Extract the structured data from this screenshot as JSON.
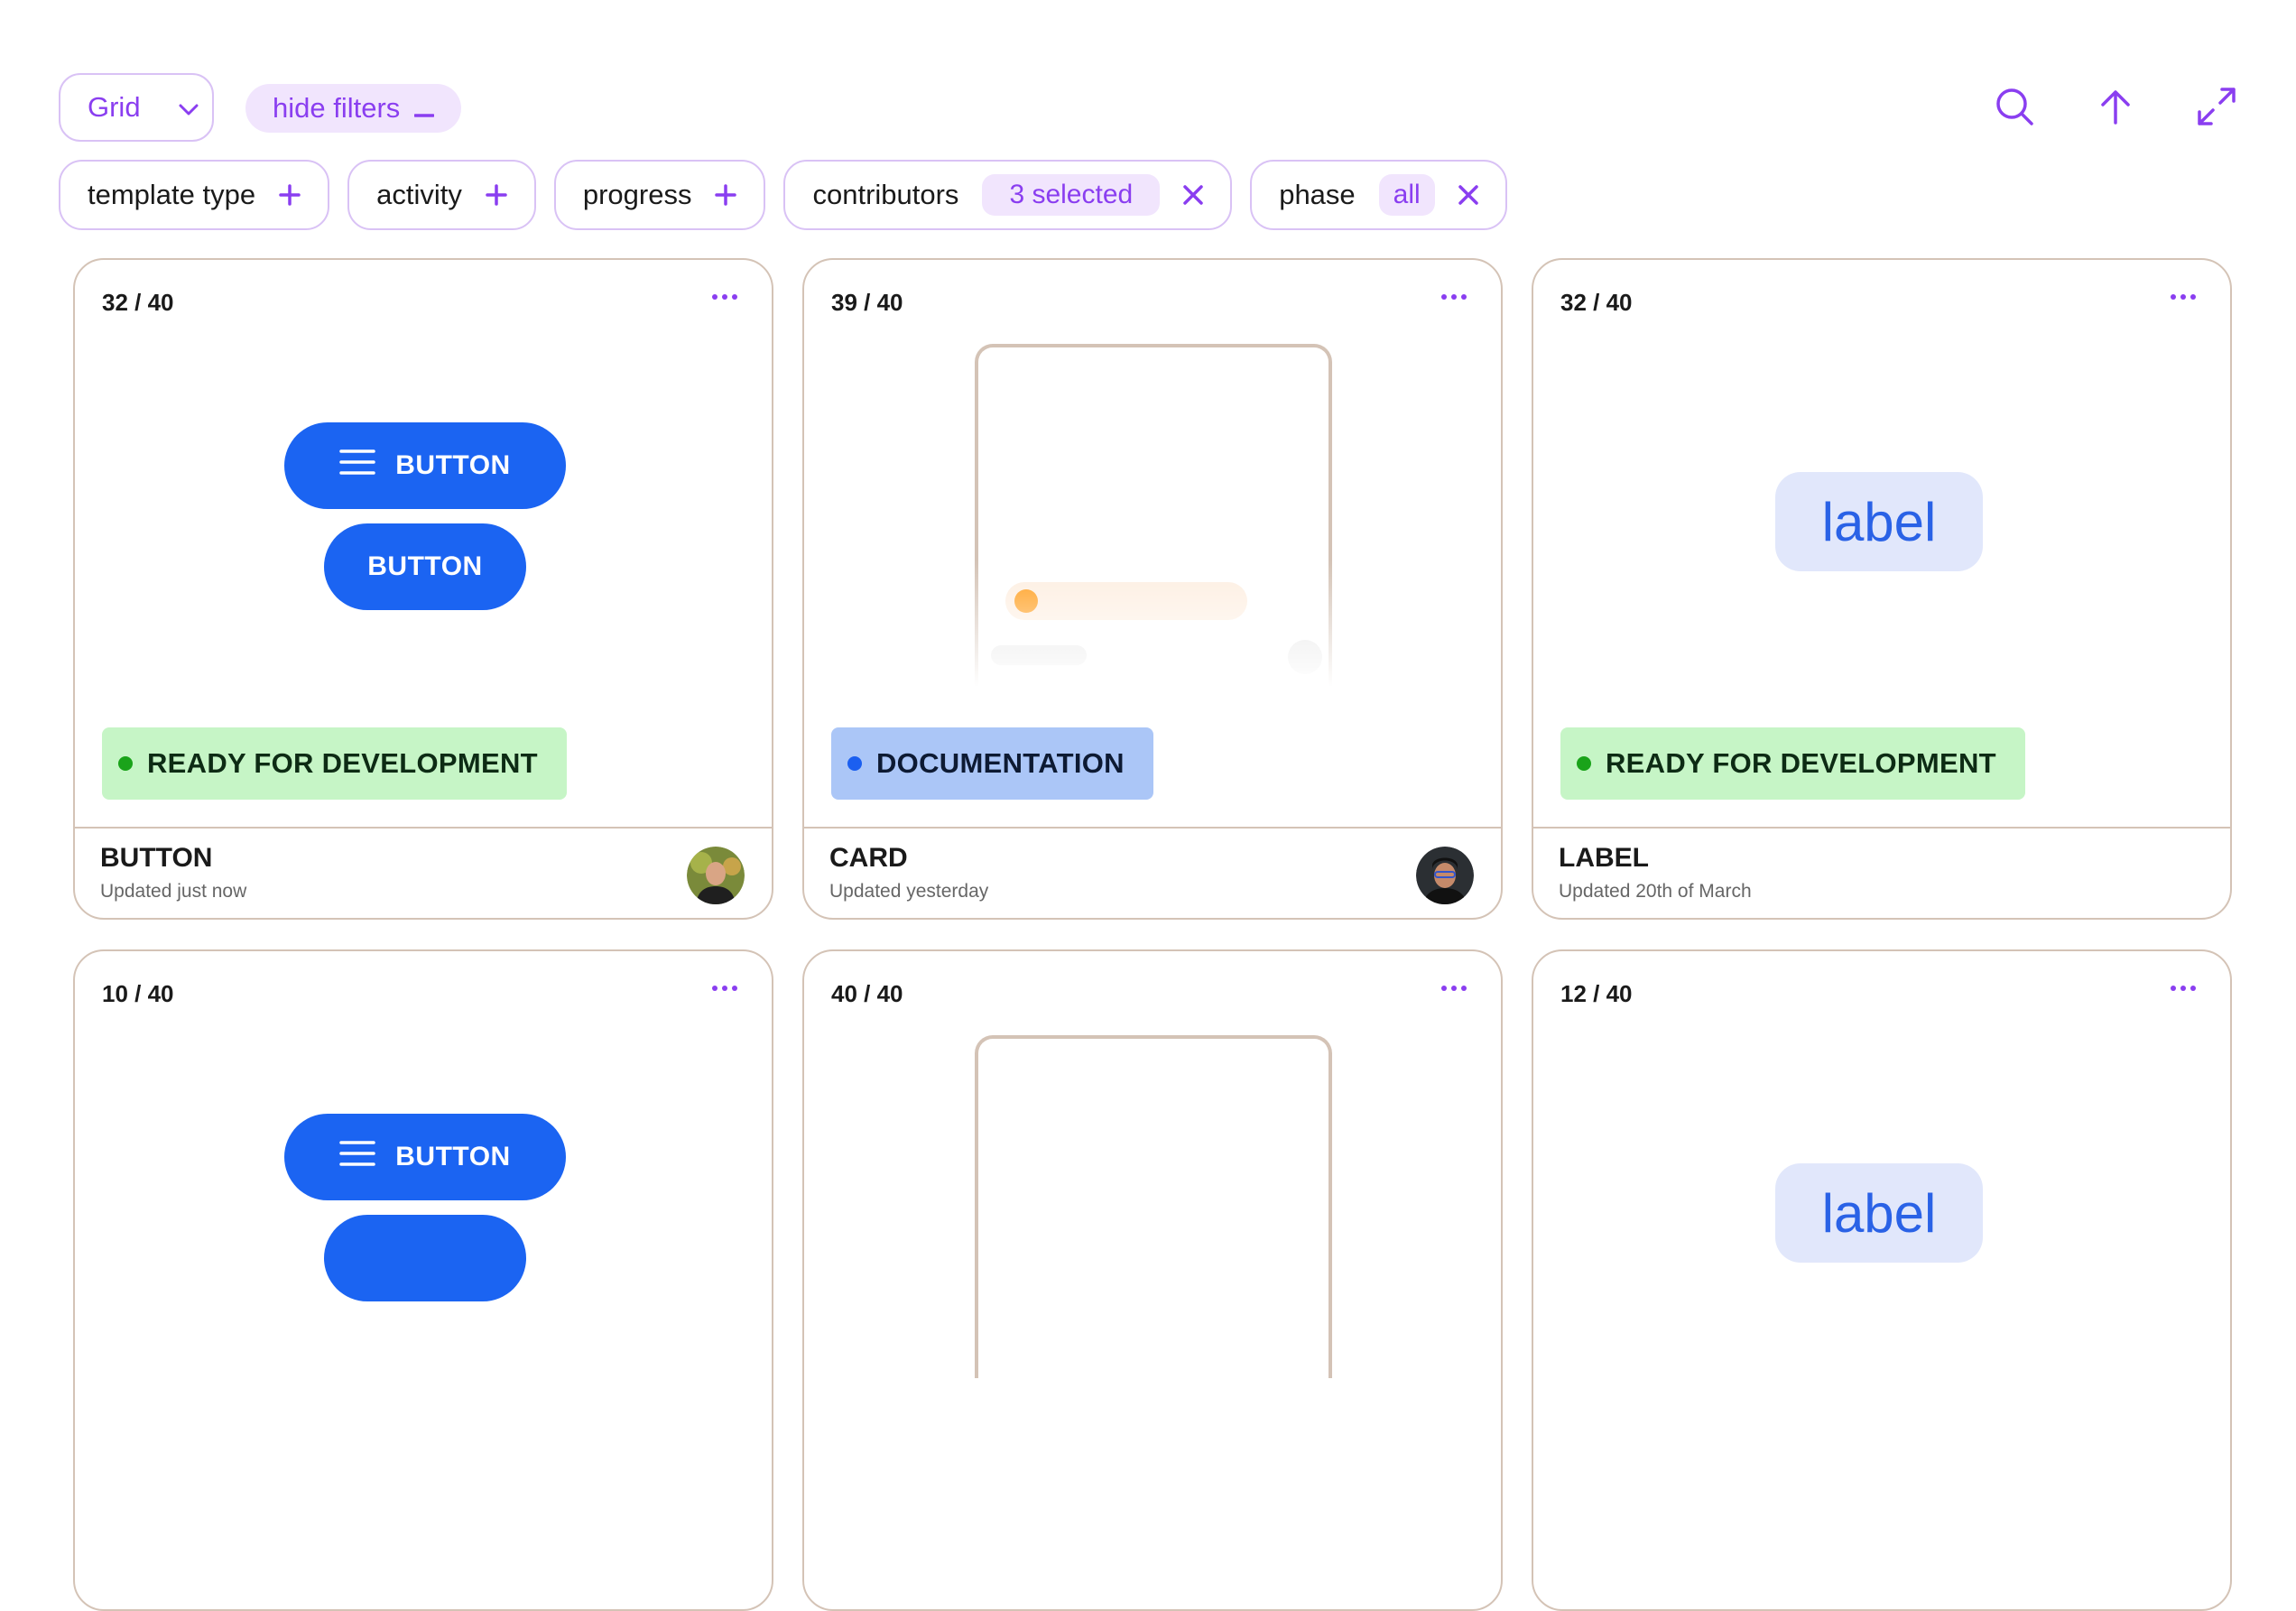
{
  "toolbar": {
    "view_value": "Grid",
    "hide_filters_label": "hide filters"
  },
  "filters": [
    {
      "label": "template type"
    },
    {
      "label": "activity"
    },
    {
      "label": "progress"
    },
    {
      "label": "contributors",
      "badge": "3 selected"
    },
    {
      "label": "phase",
      "badge": "all"
    }
  ],
  "cards": [
    {
      "count": "32 / 40",
      "status": "READY FOR DEVELOPMENT",
      "name": "BUTTON",
      "updated": "Updated just now",
      "preview": {
        "button_label": "BUTTON"
      }
    },
    {
      "count": "39 / 40",
      "status": "DOCUMENTATION",
      "name": "CARD",
      "updated": "Updated yesterday"
    },
    {
      "count": "32 / 40",
      "status": "READY FOR DEVELOPMENT",
      "name": "LABEL",
      "updated": "Updated 20th of March",
      "preview": {
        "label_text": "label"
      }
    },
    {
      "count": "10 / 40",
      "preview": {
        "button_label": "BUTTON"
      }
    },
    {
      "count": "40 / 40"
    },
    {
      "count": "12 / 40",
      "preview": {
        "label_text": "label"
      }
    }
  ],
  "colors": {
    "accent": "#8a3ef0",
    "primary_button": "#1b64f2",
    "ready_bg": "#c6f5c6",
    "docs_bg": "#abc6f7"
  }
}
